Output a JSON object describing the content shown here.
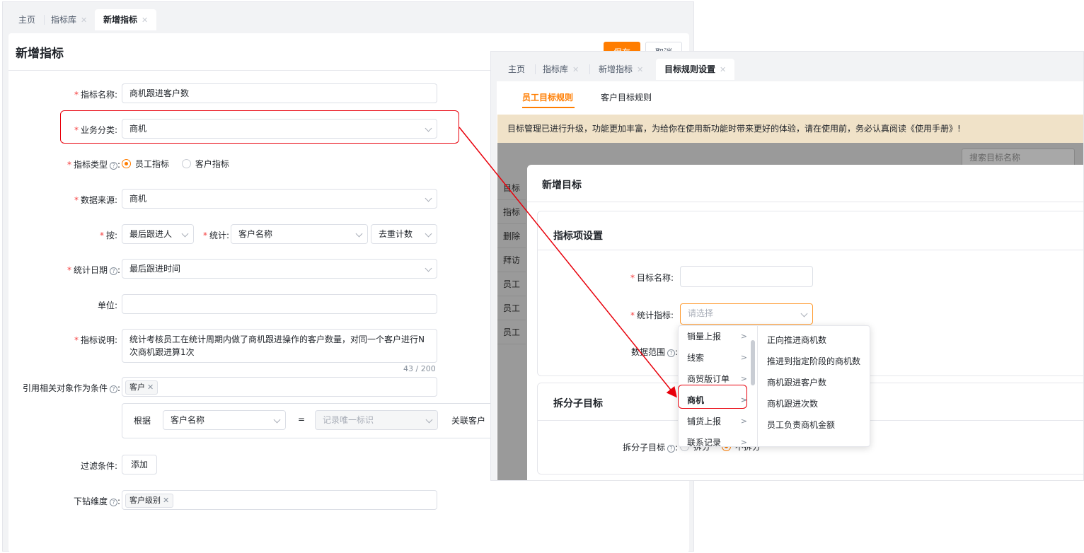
{
  "left": {
    "tabs": [
      {
        "label": "主页",
        "closable": false,
        "active": false
      },
      {
        "label": "指标库",
        "closable": true,
        "active": false
      },
      {
        "label": "新增指标",
        "closable": true,
        "active": true
      }
    ],
    "title": "新增指标",
    "save_label": "保存",
    "cancel_label": "取消",
    "form": {
      "name_label": "指标名称:",
      "name_value": "商机跟进客户数",
      "category_label": "业务分类:",
      "category_value": "商机",
      "type_label": "指标类型",
      "type_options": [
        "员工指标",
        "客户指标"
      ],
      "type_selected": "员工指标",
      "source_label": "数据来源:",
      "source_value": "商机",
      "by_label": "按:",
      "by_value": "最后跟进人",
      "stat_label": "统计:",
      "stat_value": "客户名称",
      "stat_method": "去重计数",
      "date_label": "统计日期",
      "date_value": "最后跟进时间",
      "unit_label": "单位:",
      "unit_value": "",
      "desc_label": "指标说明:",
      "desc_value": "统计考核员工在统计周期内做了商机跟进操作的客户数量，对同一个客户进行N次商机跟进算1次",
      "desc_count": "43 / 200",
      "ref_label": "引用相关对象作为条件",
      "ref_chip": "客户",
      "ref_basis_label": "根据",
      "ref_field": "客户名称",
      "ref_eq": "=",
      "ref_target_placeholder": "记录唯一标识",
      "ref_link_label": "关联客户",
      "filter_label": "过滤条件:",
      "filter_add": "添加",
      "drill_label": "下钻维度",
      "drill_chip": "客户级别"
    }
  },
  "right": {
    "tabs": [
      {
        "label": "主页",
        "closable": false,
        "active": false
      },
      {
        "label": "指标库",
        "closable": true,
        "active": false
      },
      {
        "label": "新增指标",
        "closable": true,
        "active": false
      },
      {
        "label": "目标规则设置",
        "closable": true,
        "active": true
      }
    ],
    "sub_tabs": [
      {
        "label": "员工目标规则",
        "active": true
      },
      {
        "label": "客户目标规则",
        "active": false
      }
    ],
    "banner": "目标管理已进行升级，功能更加丰富，为给你在使用新功能时带来更好的体验，请在使用前，务必认真阅读《使用手册》!",
    "bg_search_placeholder": "搜索目标名称",
    "bg_rows": [
      "目标",
      "指标",
      "删除",
      "拜访",
      "员工",
      "员工",
      "员工"
    ],
    "modal": {
      "title": "新增目标",
      "section1_title": "指标项设置",
      "goal_name_label": "目标名称:",
      "goal_name_value": "",
      "stat_indicator_label": "统计指标:",
      "stat_indicator_placeholder": "请选择",
      "data_range_label": "数据范围",
      "section2_title": "拆分子目标",
      "split_label": "拆分子目标",
      "split_options": [
        "拆分",
        "不拆分"
      ],
      "split_selected": "不拆分"
    },
    "cascader": {
      "col1": [
        "销量上报",
        "线索",
        "商贸版订单",
        "商机",
        "铺货上报",
        "联系记录"
      ],
      "col1_selected": "商机",
      "col2": [
        "正向推进商机数",
        "推进到指定阶段的商机数",
        "商机跟进客户数",
        "商机跟进次数",
        "员工负责商机金额"
      ]
    }
  },
  "colors": {
    "accent": "#ff7d00",
    "annotation": "#e8000b",
    "banner": "#f0e2c8"
  },
  "icons": [
    "close-icon",
    "chevron-down-icon",
    "help-icon",
    "chevron-right-icon"
  ]
}
